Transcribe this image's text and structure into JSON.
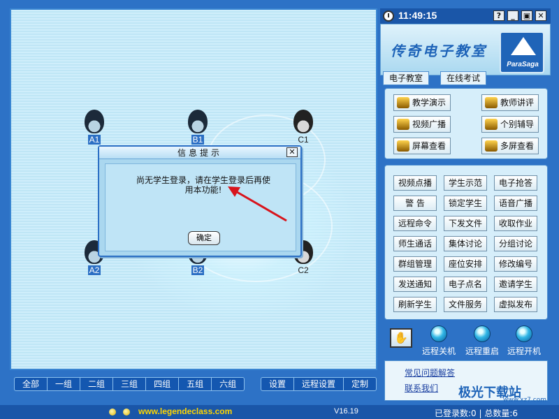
{
  "room": {
    "students": [
      {
        "label": "A1",
        "selected": true
      },
      {
        "label": "B1",
        "selected": true
      },
      {
        "label": "C1",
        "selected": false
      },
      {
        "label": "A2",
        "selected": true
      },
      {
        "label": "B2",
        "selected": true
      },
      {
        "label": "C2",
        "selected": false
      }
    ]
  },
  "dialog": {
    "title": "信息提示",
    "close": "✕",
    "message": "尚无学生登录，请在学生登录后再使用本功能!",
    "ok": "确定"
  },
  "bottom_toolbar": {
    "groups": [
      "全部",
      "一组",
      "二组",
      "三组",
      "四组",
      "五组",
      "六组"
    ],
    "settings": [
      "设置",
      "远程设置",
      "定制"
    ]
  },
  "status": {
    "url": "www.legendeclass.com",
    "version": "V16.19",
    "count": "已登录数:0 | 总数量:6"
  },
  "right": {
    "time": "11:49:15",
    "window_buttons": [
      "?",
      "_",
      "▣",
      "✕"
    ],
    "brand_title": "传奇电子教室",
    "logo_text": "ParaSaga",
    "tabs": [
      "电子教室",
      "在线考试"
    ],
    "main_buttons": [
      "教学演示",
      "教师讲评",
      "视频广播",
      "个别辅导",
      "屏幕查看",
      "多屏查看"
    ],
    "func_buttons": [
      "视频点播",
      "学生示范",
      "电子抢答",
      "警    告",
      "锁定学生",
      "语音广播",
      "远程命令",
      "下发文件",
      "收取作业",
      "师生通话",
      "集体讨论",
      "分组讨论",
      "群组管理",
      "座位安排",
      "修改编号",
      "发送通知",
      "电子点名",
      "邀请学生",
      "刷新学生",
      "文件服务",
      "虚拟发布"
    ],
    "power": [
      "远程关机",
      "远程重启",
      "远程开机"
    ],
    "links": [
      "常见问题解答",
      "联系我们"
    ]
  },
  "watermark": {
    "text": "极光下载站",
    "url": "www.xz7.com"
  },
  "colors": {
    "accent": "#2b6fc4",
    "status_url": "#ffd500",
    "arrow": "#d8141c"
  }
}
